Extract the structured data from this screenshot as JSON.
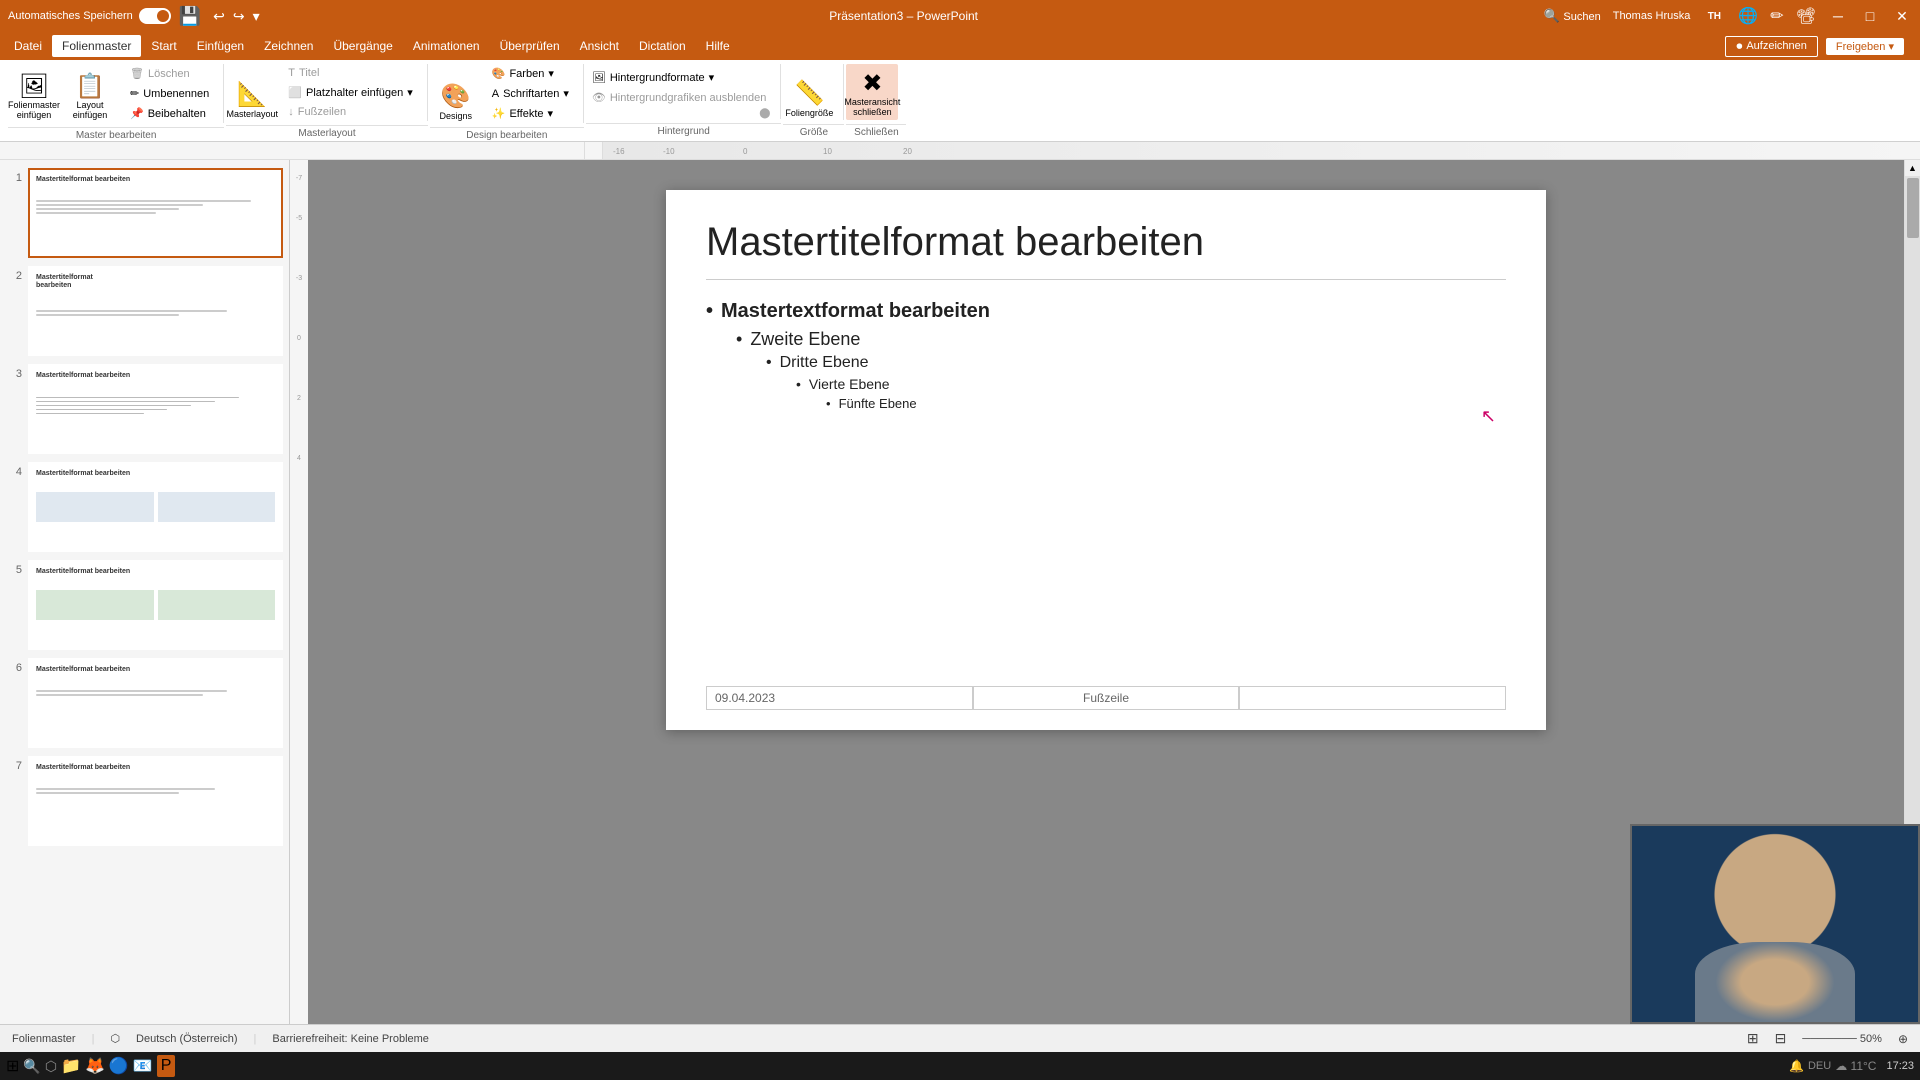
{
  "titlebar": {
    "autosave_label": "Automatisches Speichern",
    "filename": "Präsentation3",
    "app": "PowerPoint",
    "user": "Thomas Hruska",
    "search_placeholder": "Suchen"
  },
  "menubar": {
    "items": [
      {
        "id": "datei",
        "label": "Datei"
      },
      {
        "id": "folienmaster",
        "label": "Folienmaster",
        "active": true
      },
      {
        "id": "start",
        "label": "Start"
      },
      {
        "id": "einfuegen",
        "label": "Einfügen"
      },
      {
        "id": "zeichnen",
        "label": "Zeichnen"
      },
      {
        "id": "uebergaenge",
        "label": "Übergänge"
      },
      {
        "id": "animationen",
        "label": "Animationen"
      },
      {
        "id": "ueberpruefen",
        "label": "Überprüfen"
      },
      {
        "id": "ansicht",
        "label": "Ansicht"
      },
      {
        "id": "dictation",
        "label": "Dictation"
      },
      {
        "id": "hilfe",
        "label": "Hilfe"
      }
    ],
    "right": {
      "aufzeichnen": "Aufzeichnen",
      "freigeben": "Freigeben"
    }
  },
  "ribbon": {
    "groups": [
      {
        "id": "master-bearbeiten",
        "label": "Master bearbeiten",
        "buttons": [
          {
            "id": "folienmaster-einfuegen",
            "label": "Folienmaster\neinfügen",
            "icon": "🖼"
          },
          {
            "id": "layout-einfuegen",
            "label": "Layout\neinfügen",
            "icon": "📋"
          }
        ],
        "small_buttons": [
          {
            "id": "loeschen",
            "label": "Löschen",
            "icon": "🗑"
          },
          {
            "id": "umbenennen",
            "label": "Umbenennen",
            "icon": "✏"
          },
          {
            "id": "beibehalten",
            "label": "Beibehalten",
            "icon": "📌"
          }
        ]
      },
      {
        "id": "masterlayout",
        "label": "Masterlayout",
        "buttons": [
          {
            "id": "masterlayout-btn",
            "label": "Masterlayout",
            "icon": "📐"
          }
        ],
        "small_buttons": [
          {
            "id": "platzhalter-einfuegen",
            "label": "Platzhalter\neinfügen",
            "icon": "⬜"
          },
          {
            "id": "titel",
            "label": "Titel",
            "icon": "T",
            "disabled": true
          },
          {
            "id": "fusszeilen",
            "label": "Fußzeilen",
            "icon": "↓",
            "disabled": true
          }
        ]
      },
      {
        "id": "design-bearbeiten",
        "label": "Design bearbeiten",
        "buttons": [
          {
            "id": "designs",
            "label": "Designs",
            "icon": "🎨"
          }
        ],
        "small_buttons": [
          {
            "id": "farben",
            "label": "Farben",
            "icon": "🎨"
          },
          {
            "id": "schriftarten",
            "label": "Schriftarten",
            "icon": "A"
          },
          {
            "id": "effekte",
            "label": "Effekte",
            "icon": "✨"
          }
        ]
      },
      {
        "id": "hintergrund",
        "label": "Hintergrund",
        "buttons": [
          {
            "id": "hintergrundformate",
            "label": "Hintergrundformate",
            "icon": "🖼"
          },
          {
            "id": "hintergrundgrafiken-ausblenden",
            "label": "Hintergrundgrafiken ausblenden",
            "icon": "👁",
            "disabled": true
          }
        ]
      },
      {
        "id": "groesse",
        "label": "Größe",
        "buttons": [
          {
            "id": "foliengroesse",
            "label": "Foliengröße",
            "icon": "📏"
          }
        ]
      },
      {
        "id": "schliessen",
        "label": "Schließen",
        "buttons": [
          {
            "id": "masteransicht-schliessen",
            "label": "Masteransicht\nschließen",
            "icon": "✖"
          }
        ]
      }
    ]
  },
  "slides": [
    {
      "num": 1,
      "selected": true,
      "title": "Mastertitelformat bearbeiten"
    },
    {
      "num": 2,
      "selected": false,
      "title": "Mastertitelformat\nbearbeiten"
    },
    {
      "num": 3,
      "selected": false,
      "title": "Mastertitelformat bearbeiten"
    },
    {
      "num": 4,
      "selected": false,
      "title": "Mastertitelformat bearbeiten"
    },
    {
      "num": 5,
      "selected": false,
      "title": "Mastertitelformat bearbeiten"
    },
    {
      "num": 6,
      "selected": false,
      "title": "Mastertitelformat bearbeiten"
    },
    {
      "num": 7,
      "selected": false,
      "title": "Mastertitelformat bearbeiten"
    }
  ],
  "canvas": {
    "slide_title": "Mastertitelformat bearbeiten",
    "bullets": [
      {
        "level": 1,
        "text": "Mastertextformat bearbeiten"
      },
      {
        "level": 2,
        "text": "Zweite Ebene"
      },
      {
        "level": 3,
        "text": "Dritte Ebene"
      },
      {
        "level": 4,
        "text": "Vierte Ebene"
      },
      {
        "level": 5,
        "text": "Fünfte Ebene"
      }
    ],
    "footer_date": "09.04.2023",
    "footer_middle": "Fußzeile",
    "footer_right": ""
  },
  "statusbar": {
    "view": "Folienmaster",
    "language": "Deutsch (Österreich)",
    "accessibility": "Barrierefreiheit: Keine Probleme"
  },
  "colors": {
    "accent": "#c55a11",
    "white": "#ffffff",
    "light_gray": "#f5f5f5"
  }
}
